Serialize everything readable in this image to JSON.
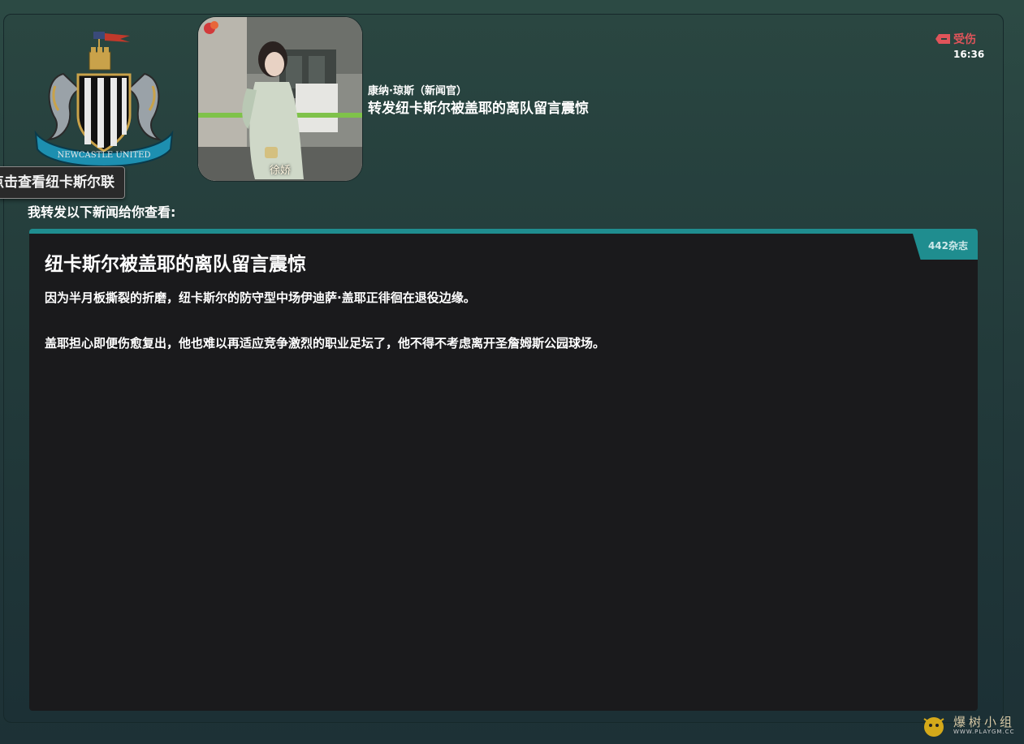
{
  "tooltip": {
    "label": "点击查看纽卡斯尔联"
  },
  "photo": {
    "caption": "徐娇"
  },
  "message": {
    "sender": "康纳·琼斯（新闻官）",
    "subject": "转发纽卡斯尔被盖耶的离队留言震惊",
    "status_label": "受伤",
    "time": "16:36",
    "intro": "我转发以下新闻给你查看:"
  },
  "article": {
    "source": "442杂志",
    "title": "纽卡斯尔被盖耶的离队留言震惊",
    "paragraphs": [
      "因为半月板撕裂的折磨，纽卡斯尔的防守型中场伊迪萨·盖耶正徘徊在退役边缘。",
      "盖耶担心即便伤愈复出，他也难以再适应竞争激烈的职业足坛了，他不得不考虑离开圣詹姆斯公园球场。"
    ]
  },
  "watermark": {
    "text": "爆树小组",
    "url": "WWW.PLAYGM.CC"
  },
  "colors": {
    "accent": "#1f8d8f",
    "injury": "#e0545a",
    "article_bg": "#1a1a1c"
  }
}
